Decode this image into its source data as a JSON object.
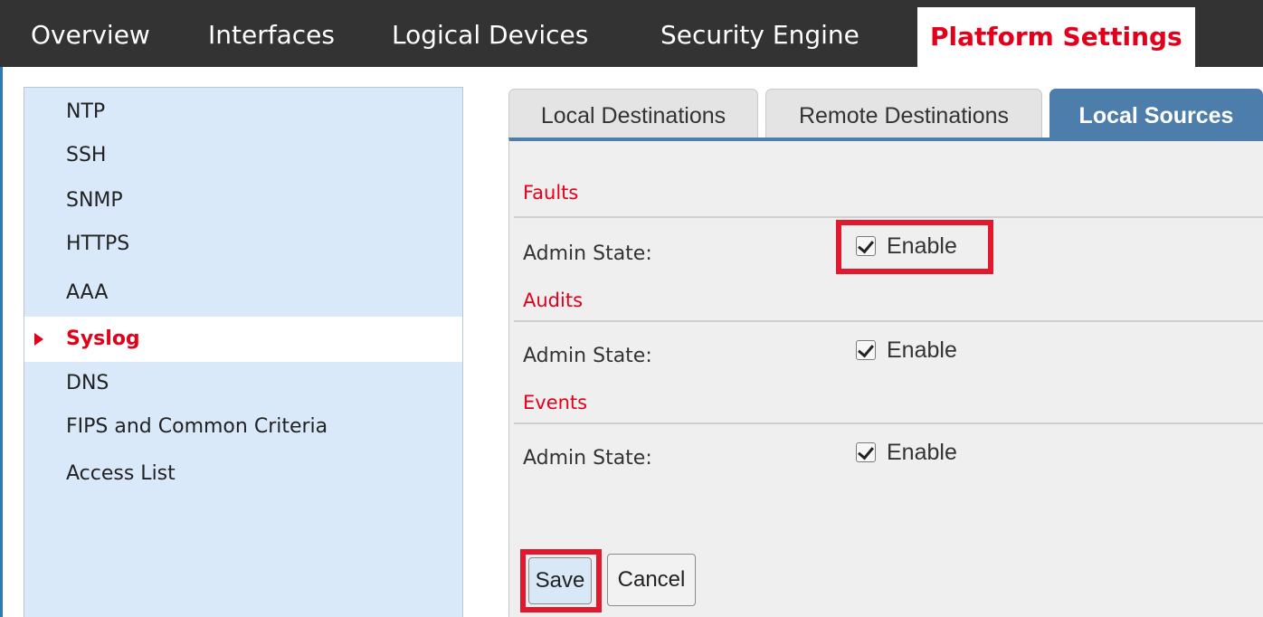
{
  "topnav": {
    "tabs": [
      {
        "label": "Overview"
      },
      {
        "label": "Interfaces"
      },
      {
        "label": "Logical Devices"
      },
      {
        "label": "Security Engine"
      },
      {
        "label": "Platform Settings"
      }
    ],
    "active_tab": "Platform Settings"
  },
  "sidebar": {
    "items": [
      {
        "label": "NTP"
      },
      {
        "label": "SSH"
      },
      {
        "label": "SNMP"
      },
      {
        "label": "HTTPS"
      },
      {
        "label": "AAA"
      },
      {
        "label": "Syslog"
      },
      {
        "label": "DNS"
      },
      {
        "label": "FIPS and Common Criteria"
      },
      {
        "label": "Access List"
      }
    ],
    "active_item": "Syslog"
  },
  "subtabs": {
    "items": [
      {
        "label": "Local Destinations"
      },
      {
        "label": "Remote Destinations"
      },
      {
        "label": "Local Sources"
      }
    ],
    "active": "Local Sources"
  },
  "sections": [
    {
      "title": "Faults",
      "row_label": "Admin State:",
      "checkbox_label": "Enable",
      "checked": true
    },
    {
      "title": "Audits",
      "row_label": "Admin State:",
      "checkbox_label": "Enable",
      "checked": true
    },
    {
      "title": "Events",
      "row_label": "Admin State:",
      "checkbox_label": "Enable",
      "checked": true
    }
  ],
  "buttons": {
    "save": "Save",
    "cancel": "Cancel"
  },
  "colors": {
    "accent_red": "#e3001b",
    "nav_bg": "#333333",
    "active_subtab": "#4d7dab",
    "sidebar_bg": "#d9e9fa",
    "panel_bg": "#efefef",
    "highlight": "#e0192e"
  }
}
